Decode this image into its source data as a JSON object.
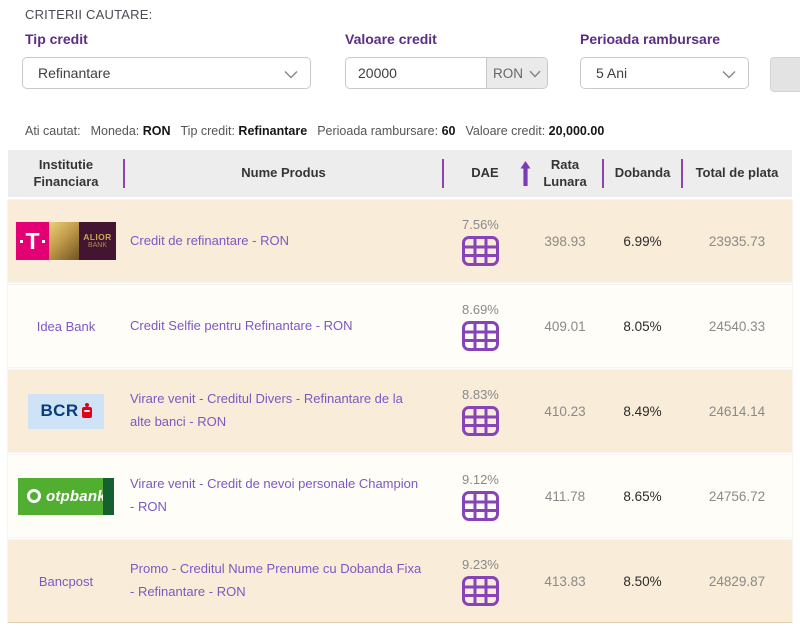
{
  "criteria": {
    "title": "CRITERII CAUTARE:",
    "fields": [
      {
        "label": "Tip credit",
        "value": "Refinantare"
      },
      {
        "label": "Valoare credit",
        "value": "20000",
        "currency": "RON"
      },
      {
        "label": "Perioada rambursare",
        "value": "5 Ani"
      }
    ]
  },
  "summary": {
    "prefix": "Ati cautat:",
    "items": [
      {
        "label": "Moneda:",
        "value": "RON"
      },
      {
        "label": "Tip credit:",
        "value": "Refinantare"
      },
      {
        "label": "Perioada rambursare:",
        "value": "60"
      },
      {
        "label": "Valoare credit:",
        "value": "20,000.00"
      }
    ]
  },
  "table": {
    "headers": {
      "institution": "Institutie Financiara",
      "product": "Nume Produs",
      "dae": "DAE",
      "rate": "Rata Lunara",
      "interest": "Dobanda",
      "total": "Total de plata"
    },
    "sort": {
      "column": "DAE",
      "direction": "ascending",
      "icon": "arrow-up-icon"
    },
    "rows": [
      {
        "institution": "Telekom / Alior Bank",
        "logo_type": "telekom-alior",
        "logo_texts": {
          "t": "T",
          "alior1": "ALIOR",
          "alior2": "BANK"
        },
        "product": "Credit de refinantare - RON",
        "dae": "7.56%",
        "rata_lunara": "398.93",
        "dobanda": "6.99%",
        "total_de_plata": "23935.73"
      },
      {
        "institution": "Idea Bank",
        "logo_type": "text",
        "product": "Credit Selfie pentru Refinantare - RON",
        "dae": "8.69%",
        "rata_lunara": "409.01",
        "dobanda": "8.05%",
        "total_de_plata": "24540.33"
      },
      {
        "institution": "BCR",
        "logo_type": "bcr",
        "logo_texts": {
          "bcr": "BCR"
        },
        "product": "Virare venit - Creditul Divers - Refinantare de la alte banci - RON",
        "dae": "8.83%",
        "rata_lunara": "410.23",
        "dobanda": "8.49%",
        "total_de_plata": "24614.14"
      },
      {
        "institution": "OTP Bank",
        "logo_type": "otp",
        "logo_texts": {
          "otp": "otpbank"
        },
        "product": "Virare venit - Credit de nevoi personale Champion - RON",
        "dae": "9.12%",
        "rata_lunara": "411.78",
        "dobanda": "8.65%",
        "total_de_plata": "24756.72"
      },
      {
        "institution": "Bancpost",
        "logo_type": "text",
        "product": "Promo - Creditul Nume Prenume cu Dobanda Fixa - Refinantare - RON",
        "dae": "9.23%",
        "rata_lunara": "413.83",
        "dobanda": "8.50%",
        "total_de_plata": "24829.87"
      }
    ]
  },
  "icons": {
    "rate_table_icon": "purple grid/repayment-schedule table",
    "sort_icon": "purple up arrow",
    "chevron_icon": "grey chevron down"
  },
  "colors": {
    "accent_purple": "#5b2d83",
    "link_purple": "#7e57c2",
    "divider_purple": "#8e44ad",
    "icon_purple": "#8644b8",
    "header_grey": "#ededed",
    "row_beige": "#f9ecd8",
    "row_white": "#fffdf8",
    "telekom_magenta": "#e20074",
    "alior_maroon": "#441533",
    "bcr_light_blue": "#cfe3f6",
    "bcr_navy": "#0a3b7c",
    "erste_red": "#e2001a",
    "otp_green": "#52ae30",
    "otp_dark_green": "#14602f"
  }
}
